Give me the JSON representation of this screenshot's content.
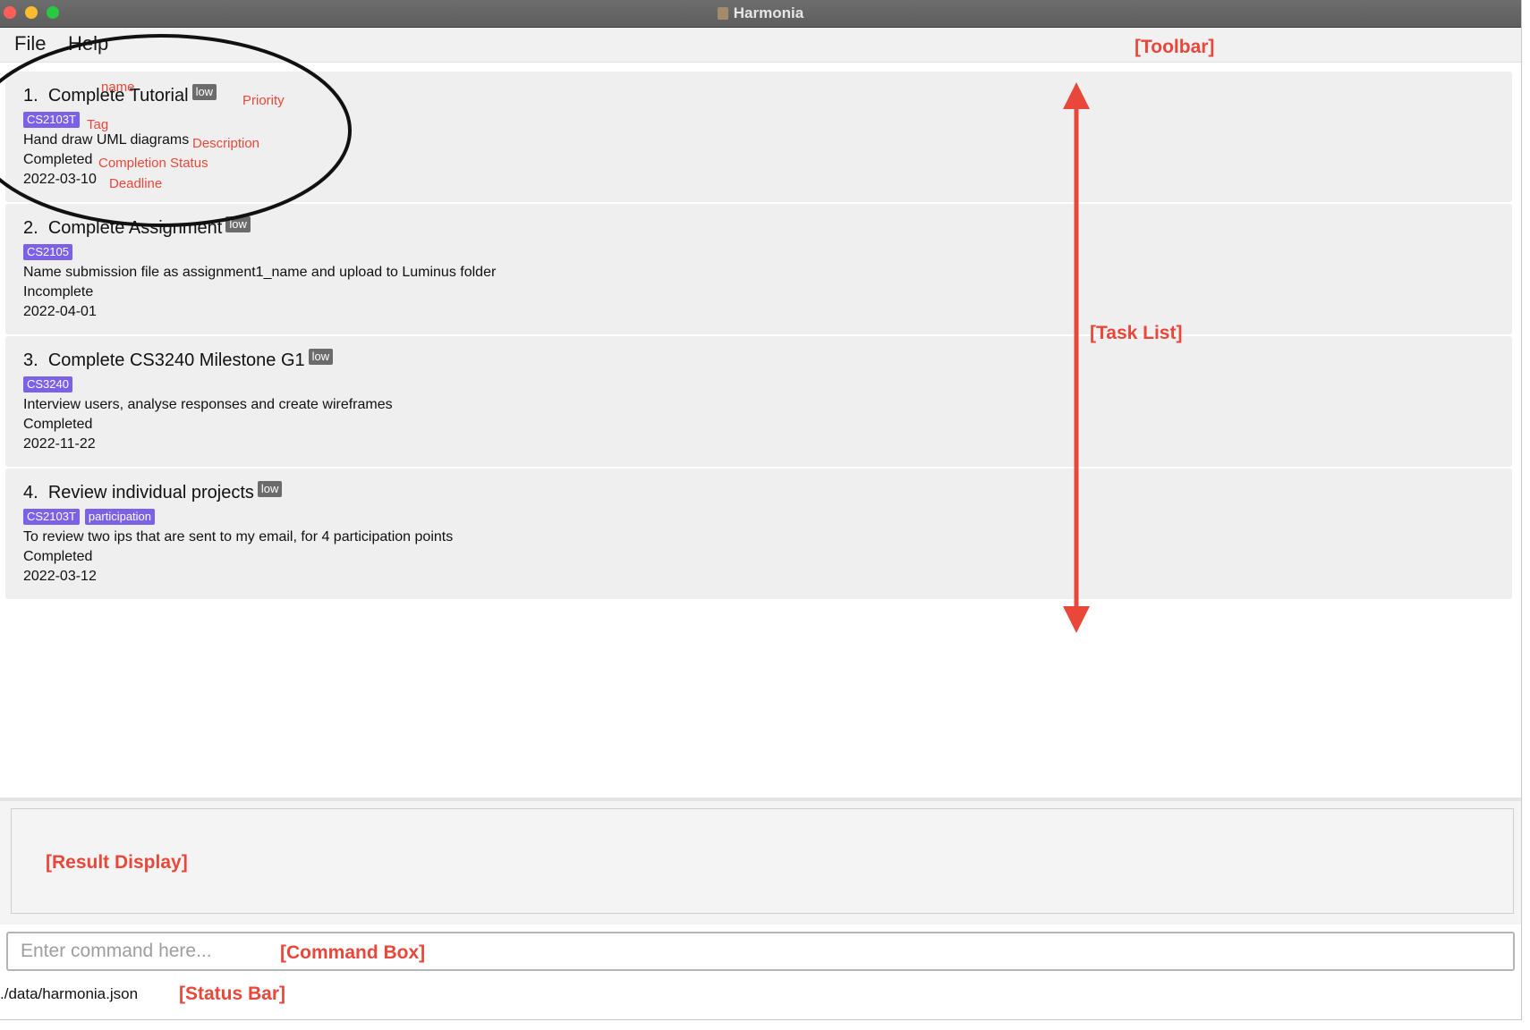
{
  "window": {
    "title": "Harmonia",
    "colors": {
      "close": "#ff5f57",
      "minimize": "#febc2e",
      "maximize": "#28c840"
    }
  },
  "menu": {
    "items": [
      {
        "label": "File"
      },
      {
        "label": "Help"
      }
    ]
  },
  "tasks": [
    {
      "index": "1.",
      "name": "Complete Tutorial",
      "priority": "low",
      "tags": [
        "CS2103T"
      ],
      "description": "Hand draw UML diagrams",
      "status": "Completed",
      "deadline": "2022-03-10"
    },
    {
      "index": "2.",
      "name": "Complete Assignment",
      "priority": "low",
      "tags": [
        "CS2105"
      ],
      "description": "Name submission file as assignment1_name and upload to Luminus folder",
      "status": "Incomplete",
      "deadline": "2022-04-01"
    },
    {
      "index": "3.",
      "name": "Complete CS3240 Milestone G1",
      "priority": "low",
      "tags": [
        "CS3240"
      ],
      "description": "Interview users, analyse responses and create wireframes",
      "status": "Completed",
      "deadline": "2022-11-22"
    },
    {
      "index": "4.",
      "name": "Review individual projects",
      "priority": "low",
      "tags": [
        "CS2103T",
        "participation"
      ],
      "description": "To review two ips that are sent to my email, for 4 participation points",
      "status": "Completed",
      "deadline": "2022-03-12"
    }
  ],
  "annotations": {
    "name": "name",
    "priority": "Priority",
    "tag": "Tag",
    "description": "Description",
    "completion_status": "Completion Status",
    "deadline": "Deadline",
    "toolbar": "[Toolbar]",
    "task_list": "[Task List]",
    "result_display": "[Result Display]",
    "command_box": "[Command Box]",
    "status_bar": "[Status Bar]",
    "color": "#e8473a"
  },
  "command_box": {
    "placeholder": "Enter command here...",
    "value": ""
  },
  "status_bar": {
    "path": "./data/harmonia.json"
  }
}
